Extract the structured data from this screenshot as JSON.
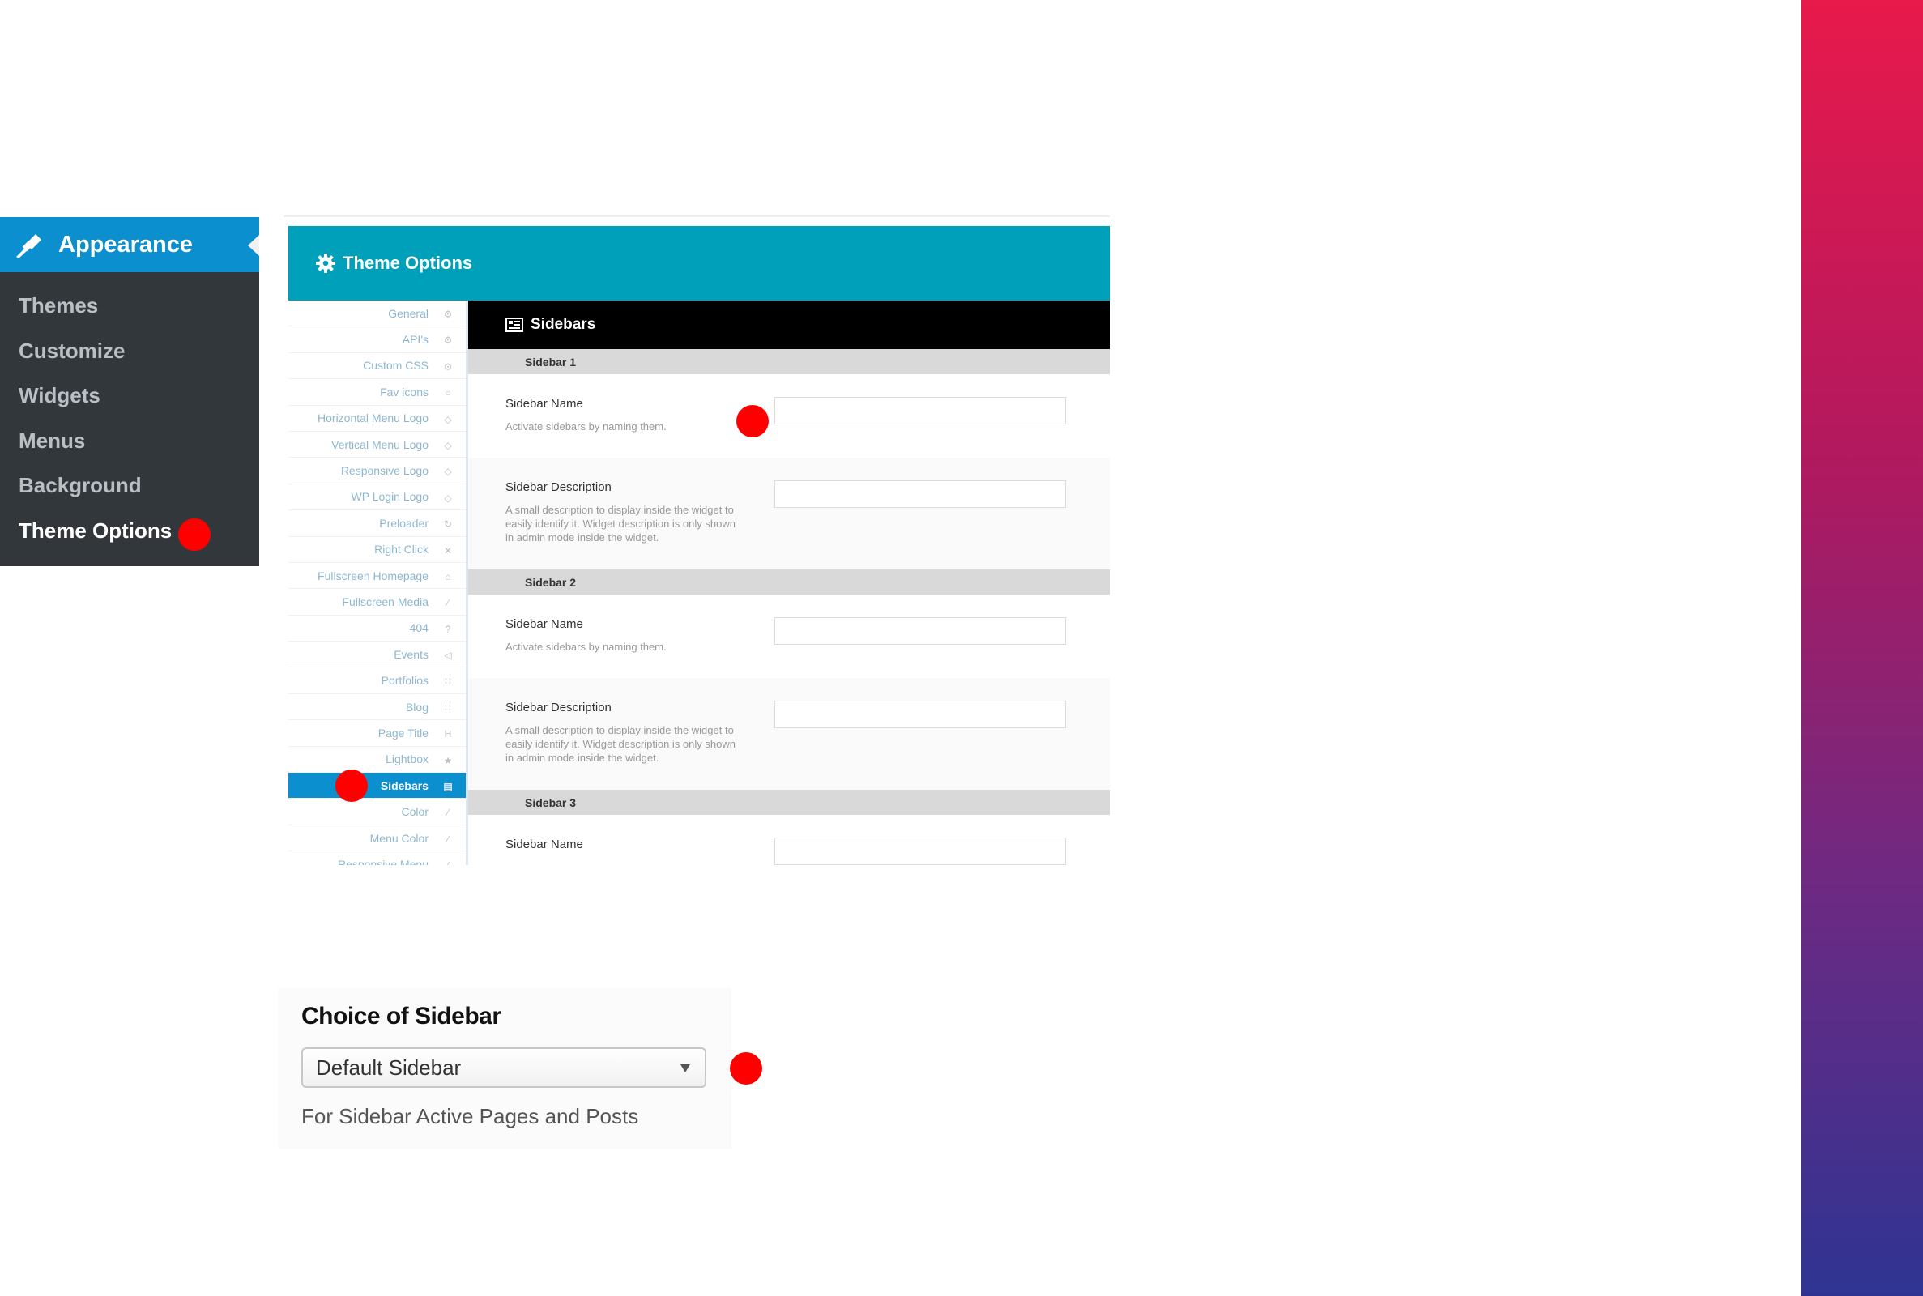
{
  "colors": {
    "wp_blue": "#0b8fcf",
    "wp_dark": "#32373c",
    "header_teal": "#00a0ba",
    "red_marker": "#ff0000",
    "gradient_top": "#e8194b",
    "gradient_bottom": "#2f3492"
  },
  "appearance_menu": {
    "title": "Appearance",
    "icon": "paintbrush-icon",
    "items": [
      {
        "label": "Themes"
      },
      {
        "label": "Customize"
      },
      {
        "label": "Widgets"
      },
      {
        "label": "Menus"
      },
      {
        "label": "Background"
      },
      {
        "label": "Theme Options",
        "current": true
      }
    ]
  },
  "theme_options": {
    "title": "Theme Options",
    "header_icon": "gear-icon",
    "nav": [
      {
        "label": "General",
        "icon": "gear-icon"
      },
      {
        "label": "API's",
        "icon": "gears-icon"
      },
      {
        "label": "Custom CSS",
        "icon": "gears-icon"
      },
      {
        "label": "Fav icons",
        "icon": "circle-icon"
      },
      {
        "label": "Horizontal Menu Logo",
        "icon": "diamond-icon"
      },
      {
        "label": "Vertical Menu Logo",
        "icon": "diamond-icon"
      },
      {
        "label": "Responsive Logo",
        "icon": "diamond-icon"
      },
      {
        "label": "WP Login Logo",
        "icon": "diamond-icon"
      },
      {
        "label": "Preloader",
        "icon": "refresh-icon"
      },
      {
        "label": "Right Click",
        "icon": "close-icon"
      },
      {
        "label": "Fullscreen Homepage",
        "icon": "home-icon"
      },
      {
        "label": "Fullscreen Media",
        "icon": "brush-icon"
      },
      {
        "label": "404",
        "icon": "question-icon"
      },
      {
        "label": "Events",
        "icon": "megaphone-icon"
      },
      {
        "label": "Portfolios",
        "icon": "grid-icon"
      },
      {
        "label": "Blog",
        "icon": "grid-icon"
      },
      {
        "label": "Page Title",
        "icon": "heading-icon"
      },
      {
        "label": "Lightbox",
        "icon": "star-icon"
      },
      {
        "label": "Sidebars",
        "icon": "sidebar-icon",
        "active": true
      },
      {
        "label": "Color",
        "icon": "brush-icon"
      },
      {
        "label": "Menu Color",
        "icon": "brush-icon"
      },
      {
        "label": "Responsive Menu",
        "icon": "brush-icon"
      }
    ],
    "section": {
      "title": "Sidebars",
      "icon": "sidebar-icon",
      "groups": [
        {
          "title": "Sidebar 1",
          "name_label": "Sidebar Name",
          "name_desc": "Activate sidebars by naming them.",
          "desc_label": "Sidebar Description",
          "desc_desc": "A small description to display inside the widget to easily identify it. Widget description is only shown in admin mode inside the widget."
        },
        {
          "title": "Sidebar 2",
          "name_label": "Sidebar Name",
          "name_desc": "Activate sidebars by naming them.",
          "desc_label": "Sidebar Description",
          "desc_desc": "A small description to display inside the widget to easily identify it. Widget description is only shown in admin mode inside the widget."
        },
        {
          "title": "Sidebar 3",
          "name_label": "Sidebar Name"
        }
      ]
    }
  },
  "choice_of_sidebar": {
    "title": "Choice of Sidebar",
    "selected": "Default Sidebar",
    "help": "For Sidebar Active Pages and Posts"
  }
}
